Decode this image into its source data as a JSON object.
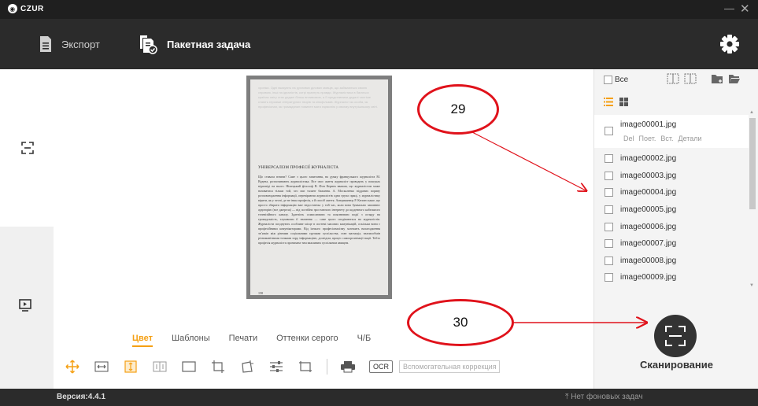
{
  "titlebar": {
    "brand": "CZUR",
    "minimize": "—",
    "close": "✕"
  },
  "toolbar": {
    "export_label": "Экспорт",
    "batch_label": "Пакетная задача"
  },
  "document": {
    "faint_text": "хроніки. Одні вказують на рухливих ділових мовців, що займаються своєю справою, інші на ідеалістів, котрі прагнуть правди. Журналістика в багатьох країнах світу стає дедалі більш впливовою, а її представники дедалі частіше стають героями літературних творів та кінофільмів. Журналіст як особа, як професіонал, як громадянин повинен мати гармонію у своєму внутрішньому світі.",
    "heading": "УНІВЕРСАЛІЗМ ПРОФЕСІЇ ЖУРНАЛІСТА",
    "body": "Що ставала взнати? Саме з цього запитання, на думку французького журналіста М. Вудена, розпочинають журналістика. Все своє життя журналіст проводить у пошуках відповіді на нього. Німецький філософ В. Фон Кернек вважав, що журналістом може називатися тільки той, хто має талант бажання. А. Москаленко відданих пориву розповсюдження інформації, перевіряючи журналістів одна група праці, у журналістику вірити, як у чесні, де не інша професія, а й спосіб життя. Американець Р. Кеппеп каже, що просто збирати інформацію вже недостатньо у той час, коли вона буквально заповнює аудиторію (все джерела) — від постійно зростаючого інтернету до щоденного кабельного телевізійного каналу. Здатність осмислювати та пояснювати події з огляду на громадськість, тлумачити її значення — саме цього сподіваються на журналістів. Журналісти поєднують особливе місце в системі масових комунікацій, оскільки вони є професійними комунікаторами. Від їхнього професіоналізму залежить налагодження зв’язків між різними соціальними групами суспільства, стан масмедіа, взаємообмін різноманітними точками зору, інформацією, досвідом, процес самоорганізації нації. Тобто професія журналіста пронизана тим важливим суспільним явищем.",
    "page_number": "158"
  },
  "tabs": [
    {
      "label": "Цвет",
      "active": true
    },
    {
      "label": "Шаблоны",
      "active": false
    },
    {
      "label": "Печати",
      "active": false
    },
    {
      "label": "Оттенки серого",
      "active": false
    },
    {
      "label": "Ч/Б",
      "active": false
    }
  ],
  "tools": {
    "icons": [
      "move-icon",
      "fit-width-icon",
      "fit-height-icon",
      "split-pages-icon",
      "full-page-icon",
      "crop-icon",
      "perspective-crop-icon",
      "adjust-icon",
      "frame-icon"
    ],
    "ocr_label": "OCR",
    "assist_placeholder": "Вспомогательная коррекция",
    "accent_color": "#f5a014"
  },
  "rightpanel": {
    "all_label": "Все",
    "first_file": {
      "name": "image00001.jpg",
      "actions": [
        "Del",
        "Поет.",
        "Вст.",
        "Детали"
      ]
    },
    "files": [
      "image00002.jpg",
      "image00003.jpg",
      "image00004.jpg",
      "image00005.jpg",
      "image00006.jpg",
      "image00007.jpg",
      "image00008.jpg",
      "image00009.jpg"
    ],
    "scan_label": "Сканирование"
  },
  "statusbar": {
    "version": "Версия:4.4.1",
    "bg_tasks": "Нет фоновых задач"
  },
  "annotations": {
    "label_a": "29",
    "label_b": "30",
    "color": "#e0121b"
  }
}
